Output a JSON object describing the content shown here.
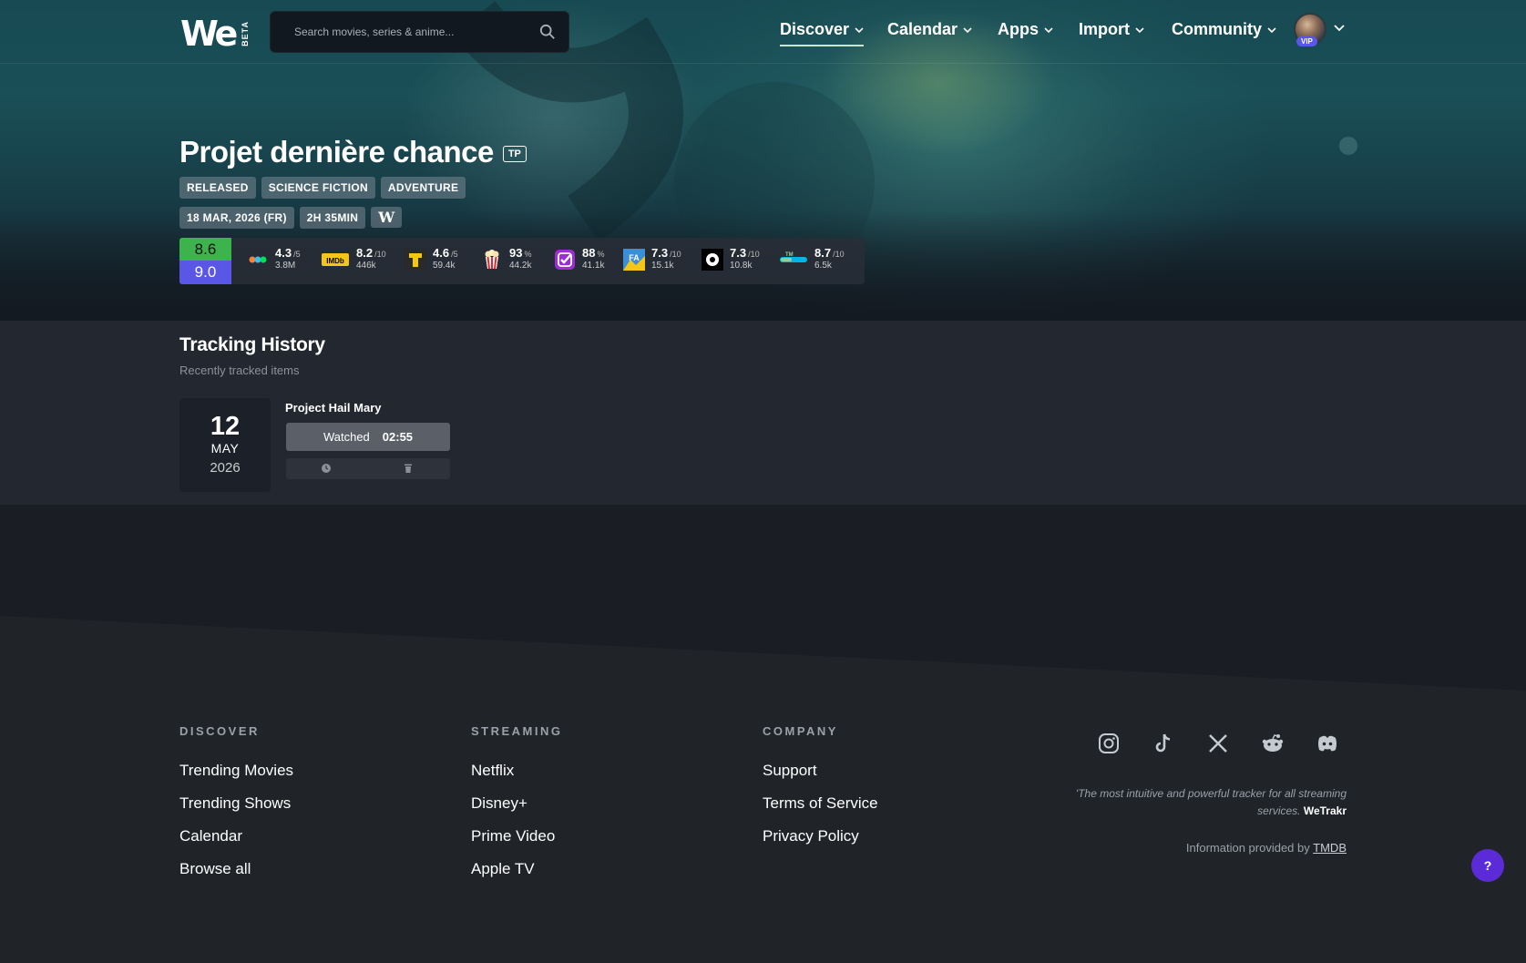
{
  "nav": {
    "logo": "We",
    "logo_badge": "BETA",
    "search_placeholder": "Search movies, series & anime...",
    "menus": [
      {
        "label": "Discover",
        "active": true
      },
      {
        "label": "Calendar",
        "active": false
      },
      {
        "label": "Apps",
        "active": false
      },
      {
        "label": "Import",
        "active": false
      },
      {
        "label": "Community",
        "active": false
      }
    ],
    "user_badge": "VIP"
  },
  "movie": {
    "title": "Projet dernière chance",
    "badge": "TP",
    "tags": [
      "RELEASED",
      "SCIENCE FICTION",
      "ADVENTURE"
    ],
    "release": "18 MAR, 2026 (FR)",
    "runtime": "2H 35MIN",
    "wiki_label": "W",
    "score_top": "8.6",
    "score_bottom": "9.0",
    "score_colors": {
      "top": "#3db34d",
      "bottom": "#5b57e6"
    },
    "ratings": [
      {
        "icon": "letterboxd-icon",
        "value": "4.3",
        "scale": "/5",
        "count": "3.8M"
      },
      {
        "icon": "imdb-icon",
        "value": "8.2",
        "scale": "/10",
        "count": "446k"
      },
      {
        "icon": "trakt-t-icon",
        "value": "4.6",
        "scale": "/5",
        "count": "59.4k"
      },
      {
        "icon": "popcorn-icon",
        "value": "93",
        "scale": "%",
        "count": "44.2k"
      },
      {
        "icon": "checkmark-icon",
        "value": "88",
        "scale": "%",
        "count": "41.1k"
      },
      {
        "icon": "filmaffinity-icon",
        "value": "7.3",
        "scale": "/10",
        "count": "15.1k"
      },
      {
        "icon": "mubi-icon",
        "value": "7.3",
        "scale": "/10",
        "count": "10.8k"
      },
      {
        "icon": "tmdb-icon",
        "value": "8.7",
        "scale": "/10",
        "count": "6.5k"
      }
    ]
  },
  "tracking": {
    "title": "Tracking History",
    "subtitle": "Recently tracked items",
    "entry": {
      "day": "12",
      "month": "MAY",
      "year": "2026",
      "item_title": "Project Hail Mary",
      "status": "Watched",
      "time": "02:55"
    }
  },
  "footer": {
    "columns": [
      {
        "heading": "DISCOVER",
        "links": [
          "Trending Movies",
          "Trending Shows",
          "Calendar",
          "Browse all"
        ]
      },
      {
        "heading": "STREAMING",
        "links": [
          "Netflix",
          "Disney+",
          "Prime Video",
          "Apple TV"
        ]
      },
      {
        "heading": "COMPANY",
        "links": [
          "Support",
          "Terms of Service",
          "Privacy Policy"
        ]
      }
    ],
    "social": [
      "instagram-icon",
      "tiktok-icon",
      "x-icon",
      "reddit-icon",
      "discord-icon"
    ],
    "quote": "'The most intuitive and powerful tracker for all streaming services.",
    "quote_brand": "WeTrakr",
    "tmdb_prefix": "Information provided by",
    "tmdb_link": "TMDB",
    "help_label": "?"
  }
}
